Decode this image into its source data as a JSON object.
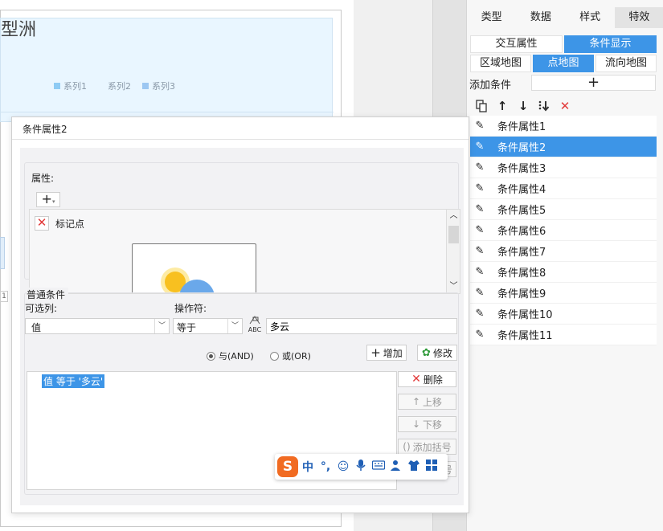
{
  "canvas": {
    "title_fragment": "型洲",
    "legend": [
      {
        "label": "系列1",
        "color": "#8ecbf4"
      },
      {
        "label": "系列2",
        "color": "#e9f6ff"
      },
      {
        "label": "系列3",
        "color": "#9cc7f2"
      }
    ],
    "left_stub_label": "1"
  },
  "right_panel": {
    "top_tabs": [
      "类型",
      "数据",
      "样式",
      "特效"
    ],
    "active_top_tab": "特效",
    "sub_tabs_1": [
      "交互属性",
      "条件显示"
    ],
    "sub_tabs_2": [
      "区域地图",
      "点地图",
      "流向地图"
    ],
    "add_condition_label": "添加条件",
    "add_condition_icon": "+",
    "toolbar_icons": [
      "copy-icon",
      "arrow-up-icon",
      "arrow-down-icon",
      "move-bottom-icon",
      "delete-icon"
    ],
    "conditions": [
      "条件属性1",
      "条件属性2",
      "条件属性3",
      "条件属性4",
      "条件属性5",
      "条件属性6",
      "条件属性7",
      "条件属性8",
      "条件属性9",
      "条件属性10",
      "条件属性11"
    ],
    "selected_index": 1
  },
  "dialog": {
    "title": "条件属性2",
    "property_label": "属性:",
    "property_add_icon": "+",
    "marker_label": "标记点",
    "normal_condition_label": "普通条件",
    "column_label": "可选列:",
    "operator_label": "操作符:",
    "column_value": "值",
    "operator_value": "等于",
    "abc_icon_text": "ABC",
    "value_input": "多云",
    "radio_and": "与(AND)",
    "radio_or": "或(OR)",
    "btn_add": "增加",
    "btn_edit": "修改",
    "condition_expression": "值 等于 '多云'",
    "btn_delete": "删除",
    "btn_up": "上移",
    "btn_down": "下移",
    "btn_add_bracket": "添加括号",
    "btn_remove_bracket": "号"
  },
  "ime": {
    "logo": "S",
    "items": [
      "中",
      "°,",
      "☺",
      "mic",
      "kbd",
      "user",
      "shirt",
      "grid"
    ],
    "lang_label": "中"
  }
}
